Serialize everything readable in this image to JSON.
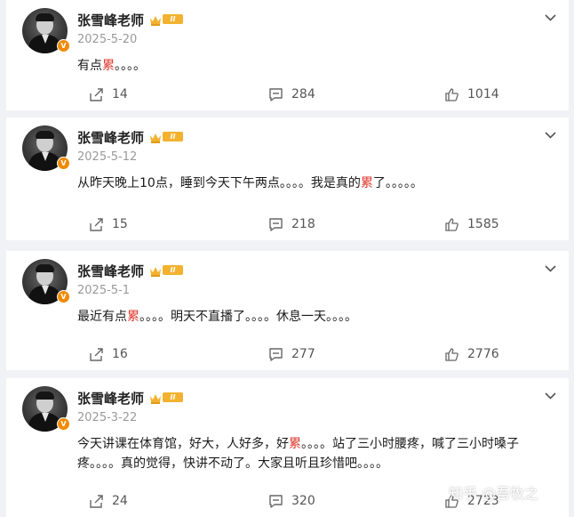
{
  "posts": [
    {
      "author": "张雪峰老师",
      "level": "II",
      "verified": "V",
      "date": "2025-5-20",
      "content": [
        {
          "t": "有点"
        },
        {
          "t": "累",
          "hl": true
        },
        {
          "t": "。。。。"
        }
      ],
      "shares": "14",
      "comments": "284",
      "likes": "1014"
    },
    {
      "author": "张雪峰老师",
      "level": "II",
      "verified": "V",
      "date": "2025-5-12",
      "content": [
        {
          "t": "从昨天晚上10点，睡到今天下午两点。。。。我是真的"
        },
        {
          "t": "累",
          "hl": true
        },
        {
          "t": "了。。。。。"
        }
      ],
      "shares": "15",
      "comments": "218",
      "likes": "1585"
    },
    {
      "author": "张雪峰老师",
      "level": "II",
      "verified": "V",
      "date": "2025-5-1",
      "content": [
        {
          "t": "最近有点"
        },
        {
          "t": "累",
          "hl": true
        },
        {
          "t": "。。。。明天不直播了。。。。休息一天。。。。"
        }
      ],
      "shares": "16",
      "comments": "277",
      "likes": "2776"
    },
    {
      "author": "张雪峰老师",
      "level": "II",
      "verified": "V",
      "date": "2025-3-22",
      "content": [
        {
          "t": "今天讲课在体育馆，好大，人好多，好"
        },
        {
          "t": "累",
          "hl": true
        },
        {
          "t": "。。。。站了三小时腰疼，喊了三小时嗓子疼。。。。真的觉得，快讲不动了。大家且听且珍惜吧。。。。"
        }
      ],
      "shares": "24",
      "comments": "320",
      "likes": "2723"
    }
  ],
  "watermark": "知乎 @吾牧之",
  "colors": {
    "highlight": "#e0362c",
    "level_badge": "#f2b230",
    "verified_badge": "#f08a00"
  }
}
